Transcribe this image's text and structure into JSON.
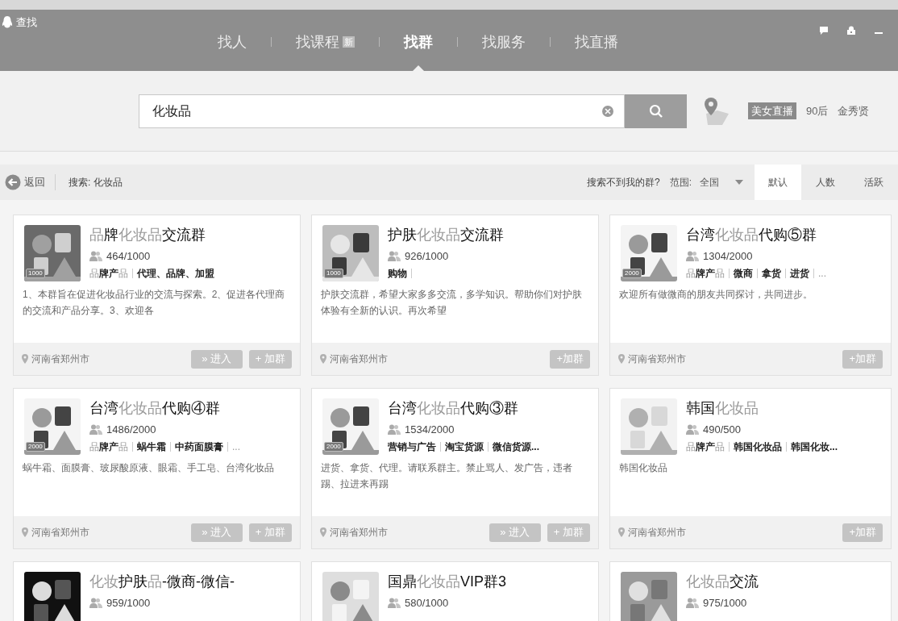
{
  "window": {
    "title": "查找"
  },
  "tabs": [
    {
      "label": "找人",
      "selected": false
    },
    {
      "label": "找课程",
      "badge": "新",
      "selected": false
    },
    {
      "label": "找群",
      "selected": true
    },
    {
      "label": "找服务",
      "selected": false
    },
    {
      "label": "找直播",
      "selected": false
    }
  ],
  "search": {
    "value": "化妆品",
    "hot_tags": [
      {
        "label": "美女直播",
        "kind": "tag"
      },
      {
        "label": "90后",
        "kind": "plain"
      },
      {
        "label": "金秀贤",
        "kind": "plain"
      }
    ]
  },
  "filter_bar": {
    "back": "返回",
    "query": "搜索: 化妆品",
    "hint": "搜索不到我的群?",
    "scope_label": "范围:",
    "scope_value": "全国",
    "sort_tabs": [
      {
        "label": "默认",
        "selected": true
      },
      {
        "label": "人数",
        "selected": false
      },
      {
        "label": "活跃",
        "selected": false
      }
    ]
  },
  "cards": [
    {
      "title": [
        {
          "text": "品",
          "highlight": true
        },
        {
          "text": "牌",
          "highlight": false
        },
        {
          "text": "化妆品",
          "highlight": true
        },
        {
          "text": "交流群",
          "highlight": false
        }
      ],
      "badge": "1000",
      "members": "464/1000",
      "tags": [
        [
          {
            "text": "品",
            "highlight": true
          },
          {
            "text": "牌产",
            "highlight": false
          },
          {
            "text": "品",
            "highlight": true
          }
        ],
        [
          {
            "text": "代理、品牌、加盟",
            "highlight": false
          }
        ]
      ],
      "description": "1、本群旨在促进化妆品行业的交流与探索。2、促进各代理商的交流和产品分享。3、欢迎各",
      "location": "河南省郑州市",
      "buttons": [
        {
          "label": "» 进入",
          "kind": "enter"
        },
        {
          "label": "+ 加群",
          "kind": "join"
        }
      ]
    },
    {
      "title": [
        {
          "text": "护肤",
          "highlight": false
        },
        {
          "text": "化妆品",
          "highlight": true
        },
        {
          "text": "交流群",
          "highlight": false
        }
      ],
      "badge": "1000",
      "members": "926/1000",
      "tags": [
        [
          {
            "text": "购物",
            "highlight": false
          }
        ]
      ],
      "trailing_divider": true,
      "description": "护肤交流群，希望大家多多交流，多学知识。帮助你们对护肤体验有全新的认识。再次希望",
      "location": "河南省郑州市",
      "buttons": [
        {
          "label": "+加群",
          "kind": "join"
        }
      ]
    },
    {
      "title": [
        {
          "text": "台湾",
          "highlight": false
        },
        {
          "text": "化妆品",
          "highlight": true
        },
        {
          "text": "代购⑤群",
          "highlight": false
        }
      ],
      "badge": "2000",
      "members": "1304/2000",
      "tags": [
        [
          {
            "text": "品",
            "highlight": true
          },
          {
            "text": "牌产",
            "highlight": false
          },
          {
            "text": "品",
            "highlight": true
          }
        ],
        [
          {
            "text": "微商",
            "highlight": false
          }
        ],
        [
          {
            "text": "拿货",
            "highlight": false
          }
        ],
        [
          {
            "text": "进货",
            "highlight": false
          }
        ],
        [
          {
            "text": "...",
            "highlight": true
          }
        ]
      ],
      "description": "欢迎所有做微商的朋友共同探讨，共同进步。",
      "location": "河南省郑州市",
      "buttons": [
        {
          "label": "+加群",
          "kind": "join"
        }
      ]
    },
    {
      "title": [
        {
          "text": "台湾",
          "highlight": false
        },
        {
          "text": "化妆品",
          "highlight": true
        },
        {
          "text": "代购④群",
          "highlight": false
        }
      ],
      "badge": "2000",
      "members": "1486/2000",
      "tags": [
        [
          {
            "text": "品",
            "highlight": true
          },
          {
            "text": "牌产",
            "highlight": false
          },
          {
            "text": "品",
            "highlight": true
          }
        ],
        [
          {
            "text": "蜗牛霜",
            "highlight": false
          }
        ],
        [
          {
            "text": "中药面膜膏",
            "highlight": false
          }
        ],
        [
          {
            "text": "...",
            "highlight": true
          }
        ]
      ],
      "description": "蜗牛霜、面膜膏、玻尿酸原液、眼霜、手工皂、台湾化妆品",
      "location": "河南省郑州市",
      "buttons": [
        {
          "label": "» 进入",
          "kind": "enter"
        },
        {
          "label": "+ 加群",
          "kind": "join"
        }
      ]
    },
    {
      "title": [
        {
          "text": "台湾",
          "highlight": false
        },
        {
          "text": "化妆品",
          "highlight": true
        },
        {
          "text": "代购③群",
          "highlight": false
        }
      ],
      "badge": "2000",
      "members": "1534/2000",
      "tags": [
        [
          {
            "text": "营销与广告",
            "highlight": false
          }
        ],
        [
          {
            "text": "淘宝货源",
            "highlight": false
          }
        ],
        [
          {
            "text": "微信货源...",
            "highlight": false
          }
        ]
      ],
      "description": "进货、拿货、代理。请联系群主。禁止骂人、发广告，违者踢、拉进来再踢",
      "location": "河南省郑州市",
      "buttons": [
        {
          "label": "» 进入",
          "kind": "enter"
        },
        {
          "label": "+ 加群",
          "kind": "join"
        }
      ]
    },
    {
      "title": [
        {
          "text": "韩国",
          "highlight": false
        },
        {
          "text": "化妆品",
          "highlight": true
        }
      ],
      "members": "490/500",
      "tags": [
        [
          {
            "text": "品",
            "highlight": true
          },
          {
            "text": "牌产",
            "highlight": false
          },
          {
            "text": "品",
            "highlight": true
          }
        ],
        [
          {
            "text": "韩国化妆品",
            "highlight": false
          }
        ],
        [
          {
            "text": "韩国化妆...",
            "highlight": false
          }
        ]
      ],
      "description": "韩国化妆品",
      "location": "河南省郑州市",
      "buttons": [
        {
          "label": "+加群",
          "kind": "join"
        }
      ]
    },
    {
      "title": [
        {
          "text": "化妆",
          "highlight": true
        },
        {
          "text": "护肤",
          "highlight": false
        },
        {
          "text": "品",
          "highlight": true
        },
        {
          "text": "-微商-微信-",
          "highlight": false
        }
      ],
      "members": "959/1000"
    },
    {
      "title": [
        {
          "text": "国鼎",
          "highlight": false
        },
        {
          "text": "化妆品",
          "highlight": true
        },
        {
          "text": "VIP群3",
          "highlight": false
        }
      ],
      "members": "580/1000"
    },
    {
      "title": [
        {
          "text": "化妆品",
          "highlight": true
        },
        {
          "text": "交流",
          "highlight": false
        }
      ],
      "members": "975/1000"
    }
  ]
}
